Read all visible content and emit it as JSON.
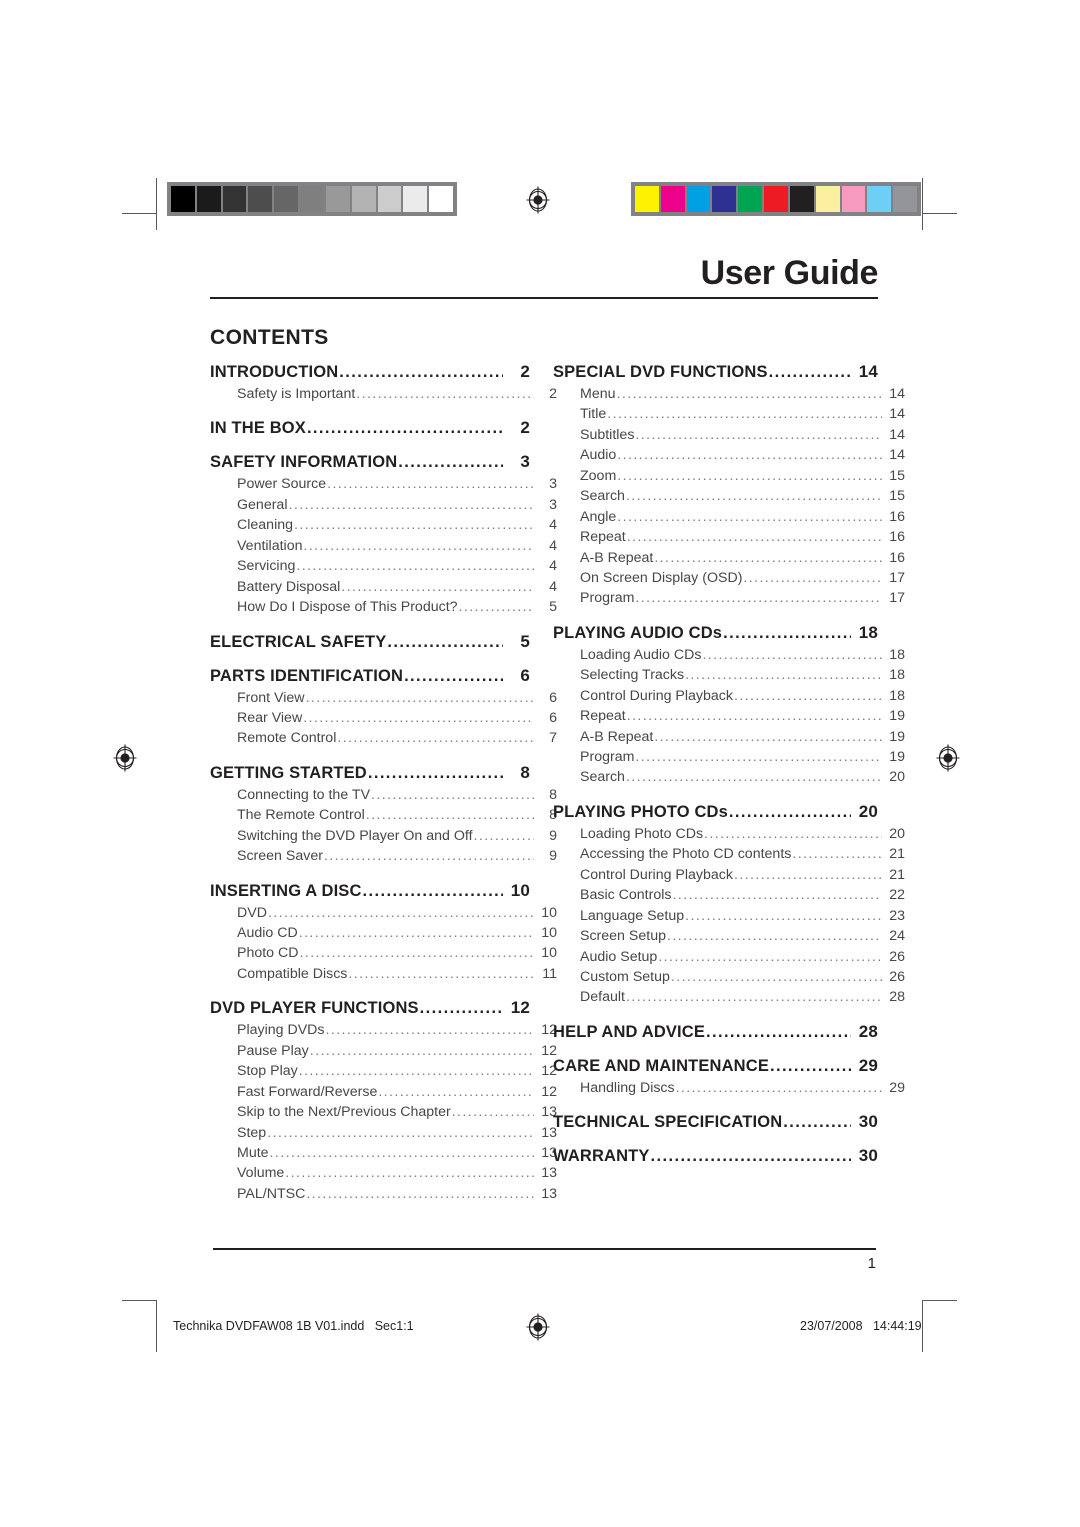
{
  "document": {
    "guide_title": "User Guide",
    "contents_heading": "CONTENTS",
    "page_number": "1"
  },
  "footer": {
    "imprint_left": "Technika DVDFAW08 1B V01.indd   Sec1:1",
    "imprint_right": "23/07/2008   14:44:19"
  },
  "calibration": {
    "grayscale_label": "grayscale-calibration-bar",
    "grayscale_swatches": [
      "#000000",
      "#1b1b1b",
      "#333333",
      "#4d4d4d",
      "#666666",
      "#7f7f7f",
      "#999999",
      "#b3b3b3",
      "#cccccc",
      "#ebebeb",
      "#ffffff"
    ],
    "color_label": "color-calibration-bar",
    "color_swatches": [
      "#fff200",
      "#ec008c",
      "#00a1e4",
      "#2e3192",
      "#00a551",
      "#ed1c24",
      "#231f20",
      "#fbf0a0",
      "#f79ac0",
      "#6dcff6",
      "#939598"
    ]
  },
  "toc": {
    "left_column": [
      {
        "level": 1,
        "label": "INTRODUCTION",
        "page": "2"
      },
      {
        "level": 2,
        "label": "Safety is Important",
        "page": "2"
      },
      {
        "level": 1,
        "label": "IN THE BOX",
        "page": "2"
      },
      {
        "level": 1,
        "label": "SAFETY INFORMATION",
        "page": "3"
      },
      {
        "level": 2,
        "label": "Power Source",
        "page": "3"
      },
      {
        "level": 2,
        "label": "General",
        "page": "3"
      },
      {
        "level": 2,
        "label": "Cleaning",
        "page": "4"
      },
      {
        "level": 2,
        "label": "Ventilation",
        "page": "4"
      },
      {
        "level": 2,
        "label": "Servicing",
        "page": "4"
      },
      {
        "level": 2,
        "label": "Battery Disposal",
        "page": "4"
      },
      {
        "level": 2,
        "label": "How Do I Dispose of This Product?",
        "page": "5"
      },
      {
        "level": 1,
        "label": "ELECTRICAL SAFETY",
        "page": "5"
      },
      {
        "level": 1,
        "label": "PARTS IDENTIFICATION",
        "page": "6"
      },
      {
        "level": 2,
        "label": "Front View",
        "page": "6"
      },
      {
        "level": 2,
        "label": "Rear View",
        "page": "6"
      },
      {
        "level": 2,
        "label": "Remote Control",
        "page": "7"
      },
      {
        "level": 1,
        "label": "GETTING STARTED",
        "page": "8"
      },
      {
        "level": 2,
        "label": "Connecting to the TV",
        "page": "8"
      },
      {
        "level": 2,
        "label": "The Remote Control",
        "page": "8"
      },
      {
        "level": 2,
        "label": "Switching the DVD Player On and Off",
        "page": "9"
      },
      {
        "level": 2,
        "label": "Screen Saver",
        "page": "9"
      },
      {
        "level": 1,
        "label": "INSERTING A DISC",
        "page": "10"
      },
      {
        "level": 2,
        "label": "DVD",
        "page": "10"
      },
      {
        "level": 2,
        "label": "Audio CD",
        "page": "10"
      },
      {
        "level": 2,
        "label": "Photo CD",
        "page": "10"
      },
      {
        "level": 2,
        "label": "Compatible Discs",
        "page": "11"
      },
      {
        "level": 1,
        "label": "DVD PLAYER FUNCTIONS",
        "page": "12"
      },
      {
        "level": 2,
        "label": "Playing DVDs",
        "page": "12"
      },
      {
        "level": 2,
        "label": "Pause Play",
        "page": "12"
      },
      {
        "level": 2,
        "label": "Stop Play",
        "page": "12"
      },
      {
        "level": 2,
        "label": "Fast Forward/Reverse",
        "page": "12"
      },
      {
        "level": 2,
        "label": "Skip to the Next/Previous Chapter",
        "page": "13"
      },
      {
        "level": 2,
        "label": "Step",
        "page": "13"
      },
      {
        "level": 2,
        "label": "Mute",
        "page": "13"
      },
      {
        "level": 2,
        "label": "Volume",
        "page": "13"
      },
      {
        "level": 2,
        "label": "PAL/NTSC",
        "page": "13"
      }
    ],
    "right_column": [
      {
        "level": 1,
        "label": "SPECIAL DVD FUNCTIONS",
        "page": "14"
      },
      {
        "level": 2,
        "label": "Menu",
        "page": "14"
      },
      {
        "level": 2,
        "label": "Title",
        "page": "14"
      },
      {
        "level": 2,
        "label": "Subtitles",
        "page": "14"
      },
      {
        "level": 2,
        "label": "Audio",
        "page": "14"
      },
      {
        "level": 2,
        "label": "Zoom",
        "page": "15"
      },
      {
        "level": 2,
        "label": "Search",
        "page": "15"
      },
      {
        "level": 2,
        "label": "Angle",
        "page": "16"
      },
      {
        "level": 2,
        "label": "Repeat",
        "page": "16"
      },
      {
        "level": 2,
        "label": "A-B Repeat",
        "page": "16"
      },
      {
        "level": 2,
        "label": "On Screen Display (OSD)",
        "page": "17"
      },
      {
        "level": 2,
        "label": "Program",
        "page": "17"
      },
      {
        "level": 1,
        "label": "PLAYING AUDIO CDs",
        "page": "18"
      },
      {
        "level": 2,
        "label": "Loading Audio CDs",
        "page": "18"
      },
      {
        "level": 2,
        "label": "Selecting Tracks",
        "page": "18"
      },
      {
        "level": 2,
        "label": "Control During Playback",
        "page": "18"
      },
      {
        "level": 2,
        "label": "Repeat",
        "page": "19"
      },
      {
        "level": 2,
        "label": "A-B Repeat",
        "page": "19"
      },
      {
        "level": 2,
        "label": "Program",
        "page": "19"
      },
      {
        "level": 2,
        "label": "Search",
        "page": "20"
      },
      {
        "level": 1,
        "label": "PLAYING PHOTO CDs",
        "page": "20"
      },
      {
        "level": 2,
        "label": "Loading Photo CDs",
        "page": "20"
      },
      {
        "level": 2,
        "label": "Accessing the Photo CD contents",
        "page": "21"
      },
      {
        "level": 2,
        "label": "Control During Playback",
        "page": "21"
      },
      {
        "level": 2,
        "label": "Basic Controls",
        "page": "22"
      },
      {
        "level": 2,
        "label": "Language Setup",
        "page": "23"
      },
      {
        "level": 2,
        "label": "Screen Setup",
        "page": "24"
      },
      {
        "level": 2,
        "label": "Audio Setup",
        "page": "26"
      },
      {
        "level": 2,
        "label": "Custom Setup",
        "page": "26"
      },
      {
        "level": 2,
        "label": "Default",
        "page": "28"
      },
      {
        "level": 1,
        "label": "HELP AND ADVICE",
        "page": "28"
      },
      {
        "level": 1,
        "label": "CARE AND MAINTENANCE",
        "page": "29"
      },
      {
        "level": 2,
        "label": "Handling Discs",
        "page": "29"
      },
      {
        "level": 1,
        "label": "TECHNICAL SPECIFICATION",
        "page": "30"
      },
      {
        "level": 1,
        "label": "WARRANTY",
        "page": "30"
      }
    ]
  }
}
